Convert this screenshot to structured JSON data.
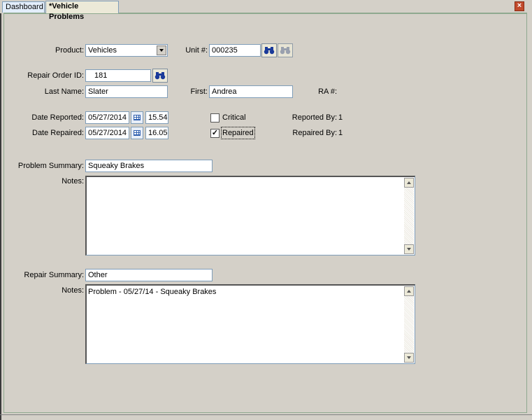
{
  "tabs": [
    {
      "label": "Dashboard",
      "active": false
    },
    {
      "label": "*Vehicle Problems",
      "active": true
    }
  ],
  "close_glyph": "×",
  "form": {
    "product": {
      "label": "Product:",
      "value": "Vehicles"
    },
    "unit": {
      "label": "Unit #:",
      "value": "000235"
    },
    "repair_order": {
      "label": "Repair Order ID:",
      "value": "181"
    },
    "last_name": {
      "label": "Last Name:",
      "value": "Slater"
    },
    "first_name": {
      "label": "First:",
      "value": "Andrea"
    },
    "ra": {
      "label": "RA #:",
      "value": ""
    },
    "date_reported": {
      "label": "Date Reported:",
      "date": "05/27/2014",
      "time": "15.54"
    },
    "date_repaired": {
      "label": "Date Repaired:",
      "date": "05/27/2014",
      "time": "16.05"
    },
    "critical": {
      "label": "Critical",
      "checked": false
    },
    "repaired": {
      "label": "Repaired",
      "checked": true
    },
    "reported_by": {
      "label": "Reported By:",
      "value": "1"
    },
    "repaired_by": {
      "label": "Repaired By:",
      "value": "1"
    },
    "problem_summary": {
      "label": "Problem Summary:",
      "value": "Squeaky Brakes"
    },
    "problem_notes": {
      "label": "Notes:",
      "value": ""
    },
    "repair_summary": {
      "label": "Repair Summary:",
      "value": "Other"
    },
    "repair_notes": {
      "label": "Notes:",
      "value": "Problem - 05/27/14 - Squeaky Brakes"
    }
  },
  "icons": {
    "search": "binoculars-icon",
    "calendar": "calendar-icon",
    "close": "close-icon",
    "check_mark": "✓"
  }
}
